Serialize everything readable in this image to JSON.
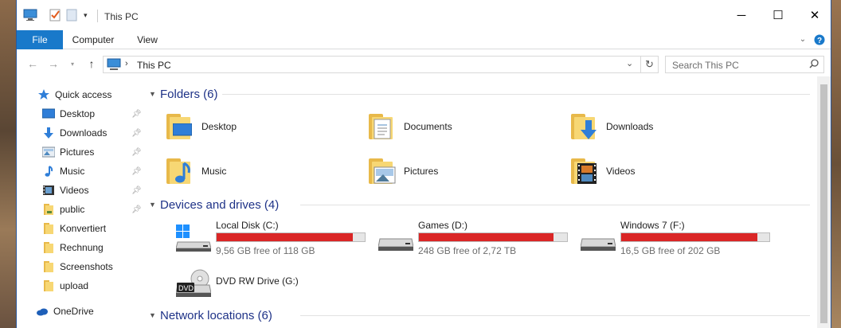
{
  "window": {
    "title": "This PC"
  },
  "ribbon": {
    "tabs": [
      "File",
      "Computer",
      "View"
    ]
  },
  "address": {
    "path": "This PC",
    "search_placeholder": "Search This PC"
  },
  "sidebar": {
    "quick_access": "Quick access",
    "items": [
      {
        "label": "Desktop",
        "icon": "desktop-icon",
        "pinned": true
      },
      {
        "label": "Downloads",
        "icon": "downloads-icon",
        "pinned": true
      },
      {
        "label": "Pictures",
        "icon": "pictures-icon",
        "pinned": true
      },
      {
        "label": "Music",
        "icon": "music-icon",
        "pinned": true
      },
      {
        "label": "Videos",
        "icon": "videos-icon",
        "pinned": true
      },
      {
        "label": "public",
        "icon": "folder-icon",
        "pinned": true
      },
      {
        "label": "Konvertiert",
        "icon": "folder-icon",
        "pinned": false
      },
      {
        "label": "Rechnung",
        "icon": "folder-icon",
        "pinned": false
      },
      {
        "label": "Screenshots",
        "icon": "folder-icon",
        "pinned": false
      },
      {
        "label": "upload",
        "icon": "folder-icon",
        "pinned": false
      }
    ],
    "onedrive": "OneDrive"
  },
  "groups": {
    "folders": "Folders (6)",
    "devices": "Devices and drives (4)",
    "network": "Network locations (6)"
  },
  "folders": [
    {
      "label": "Desktop",
      "icon": "desktop-folder-icon"
    },
    {
      "label": "Documents",
      "icon": "documents-folder-icon"
    },
    {
      "label": "Downloads",
      "icon": "downloads-folder-icon"
    },
    {
      "label": "Music",
      "icon": "music-folder-icon"
    },
    {
      "label": "Pictures",
      "icon": "pictures-folder-icon"
    },
    {
      "label": "Videos",
      "icon": "videos-folder-icon"
    }
  ],
  "drives": [
    {
      "name": "Local Disk (C:)",
      "free": "9,56 GB free of 118 GB",
      "used_fraction": 0.92
    },
    {
      "name": "Games (D:)",
      "free": "248 GB free of 2,72 TB",
      "used_fraction": 0.91
    },
    {
      "name": "Windows 7 (F:)",
      "free": "16,5 GB free of 202 GB",
      "used_fraction": 0.92
    }
  ],
  "dvd": {
    "name": "DVD RW Drive (G:)",
    "badge": "DVD"
  },
  "colors": {
    "accent": "#1979ca",
    "bar_full": "#da2626",
    "group_title": "#1e3287"
  }
}
